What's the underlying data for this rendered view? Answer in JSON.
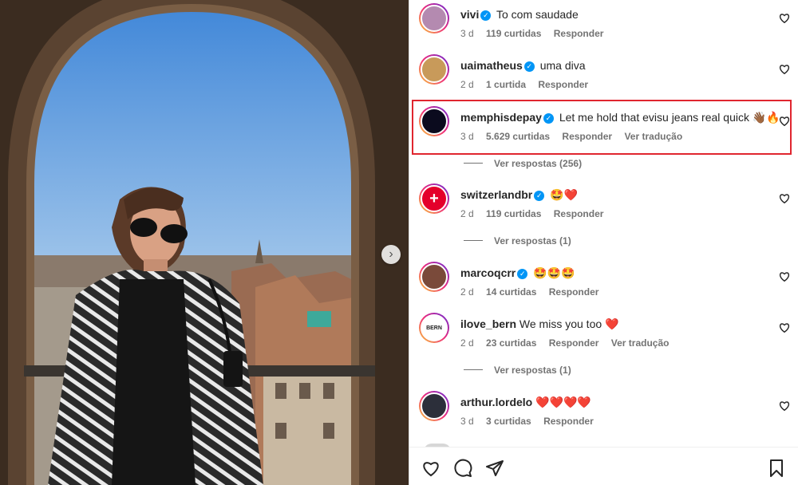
{
  "photo": {
    "next_icon": "chevron-right-icon"
  },
  "comments": [
    {
      "username": "vivi",
      "verified": true,
      "text": "To com saudade",
      "age": "3 d",
      "likes": "119 curtidas",
      "reply": "Responder",
      "translate": "",
      "replies": ""
    },
    {
      "username": "uaimatheus",
      "verified": true,
      "text": "uma diva",
      "age": "2 d",
      "likes": "1 curtida",
      "reply": "Responder",
      "translate": "",
      "replies": ""
    },
    {
      "username": "memphisdepay",
      "verified": true,
      "text": "Let me hold that evisu jeans real quick 👋🏾🔥",
      "age": "3 d",
      "likes": "5.629 curtidas",
      "reply": "Responder",
      "translate": "Ver tradução",
      "replies": "Ver respostas (256)"
    },
    {
      "username": "switzerlandbr",
      "verified": true,
      "text": "🤩❤️",
      "age": "2 d",
      "likes": "119 curtidas",
      "reply": "Responder",
      "translate": "",
      "replies": "Ver respostas (1)"
    },
    {
      "username": "marcoqcrr",
      "verified": true,
      "text": "🤩🤩🤩",
      "age": "2 d",
      "likes": "14 curtidas",
      "reply": "Responder",
      "translate": "",
      "replies": ""
    },
    {
      "username": "ilove_bern",
      "verified": false,
      "text": "We miss you too ❤️",
      "age": "2 d",
      "likes": "23 curtidas",
      "reply": "Responder",
      "translate": "Ver tradução",
      "replies": "Ver respostas (1)"
    },
    {
      "username": "arthur.lordelo",
      "verified": false,
      "text": "❤️❤️❤️❤️",
      "age": "3 d",
      "likes": "3 curtidas",
      "reply": "Responder",
      "translate": "",
      "replies": ""
    }
  ],
  "avatar_colors": [
    "#b48ab0",
    "#c89a5a",
    "#0b0b1e",
    "#e4002b",
    "#7a4a3a",
    "#ffffff",
    "#2c2f3a"
  ],
  "ilove_bern_avatar_text": "BERN",
  "actions": {
    "like": "heart-icon",
    "comment": "comment-icon",
    "share": "send-icon",
    "save": "bookmark-icon"
  },
  "colors": {
    "verified": "#0095f6",
    "highlight": "#e0262f",
    "muted": "#737373"
  }
}
